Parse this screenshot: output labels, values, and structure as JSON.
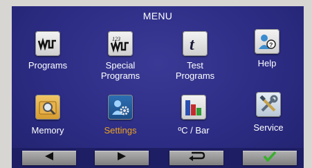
{
  "menu": {
    "title": "MENU",
    "items": [
      {
        "label": "Programs",
        "icon": "waveform-icon"
      },
      {
        "label": "Special\nPrograms",
        "icon": "special-waveform-icon"
      },
      {
        "label": "Test\nPrograms",
        "icon": "letter-t-icon"
      },
      {
        "label": "Help",
        "icon": "help-user-icon"
      },
      {
        "label": "Memory",
        "icon": "magnifier-folder-icon"
      },
      {
        "label": "Settings",
        "icon": "settings-gear-user-icon",
        "selected": true
      },
      {
        "label": "ºC / Bar",
        "icon": "bar-chart-icon"
      },
      {
        "label": "Service",
        "icon": "tools-icon"
      }
    ]
  },
  "nav": {
    "buttons": [
      {
        "icon": "arrow-left-icon"
      },
      {
        "icon": "arrow-right-icon"
      },
      {
        "icon": "return-icon"
      },
      {
        "icon": "checkmark-icon"
      }
    ]
  },
  "colors": {
    "screen_background": "#2c2c84",
    "selected_label": "#f0a31c",
    "checkmark": "#35b02a"
  }
}
